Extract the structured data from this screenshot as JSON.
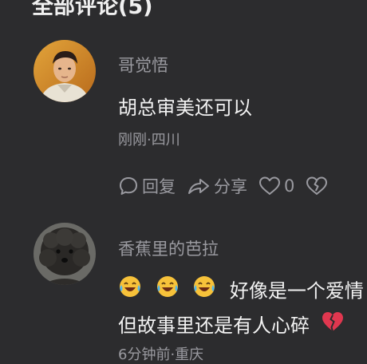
{
  "section_title": "全部评论(5)",
  "comments": [
    {
      "author": "哥觉悟",
      "text": "胡总审美还可以",
      "meta": "刚刚·四川",
      "actions": {
        "reply": "回复",
        "share": "分享",
        "like_count": "0"
      }
    },
    {
      "author": "香蕉里的芭拉",
      "line1": "好像是一个爱情",
      "line2": "但故事里还是有人心碎",
      "meta": "6分钟前·重庆"
    }
  ],
  "icons": [
    "reply-icon",
    "share-icon",
    "heart-icon",
    "dislike-icon",
    "laugh-cry-emoji",
    "broken-heart-emoji"
  ],
  "colors": {
    "background": "#2c2c2e",
    "primary_text": "#f2f2f2",
    "secondary_text": "#9a9aa0",
    "broken_heart": "#e0374f",
    "emoji_yellow": "#f7c23a"
  }
}
